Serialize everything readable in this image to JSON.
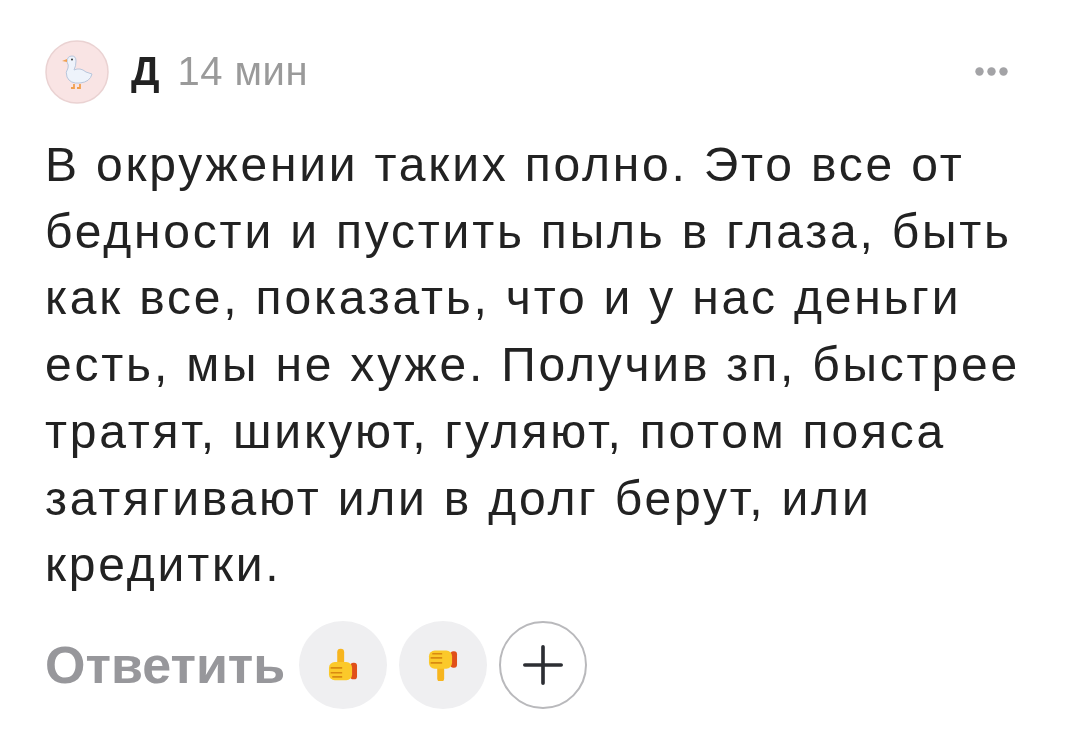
{
  "comment": {
    "author": "Д",
    "time": "14 мин",
    "text": "В окружении таких полно. Это все от бедности и пустить пыль в глаза, быть как все, показать, что и у нас деньги есть, мы не хуже. Получив зп, быстрее тратят, шикуют, гуляют, потом пояса затягивают или в долг берут, или кредитки.",
    "reply": "Ответить",
    "reactions": [
      {
        "kind": "like"
      },
      {
        "kind": "dislike"
      },
      {
        "kind": "add"
      }
    ]
  }
}
